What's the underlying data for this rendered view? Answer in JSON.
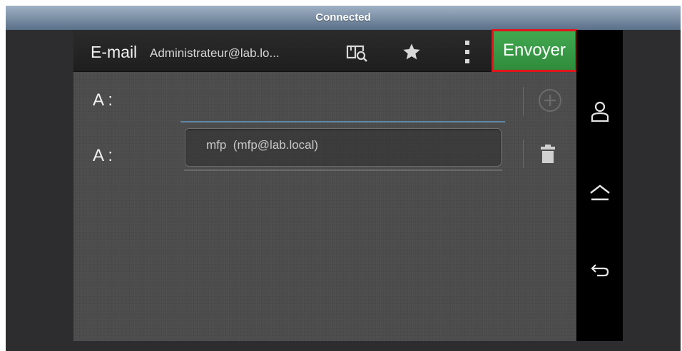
{
  "status_bar": {
    "text": "Connected"
  },
  "action_bar": {
    "title": "E-mail",
    "account": "Administrateur@lab.lo...",
    "send_label": "Envoyer",
    "icons": [
      "address-book-search-icon",
      "star-icon",
      "overflow-menu-icon"
    ],
    "send_color": "#3a9d47",
    "highlight_color": "#e0161b"
  },
  "recipients": [
    {
      "label": "A :",
      "value": ""
    },
    {
      "label": "A :",
      "value": "mfp  (mfp@lab.local)"
    }
  ],
  "nav_bar": {
    "icons": [
      "user-icon",
      "home-icon",
      "back-icon"
    ]
  }
}
